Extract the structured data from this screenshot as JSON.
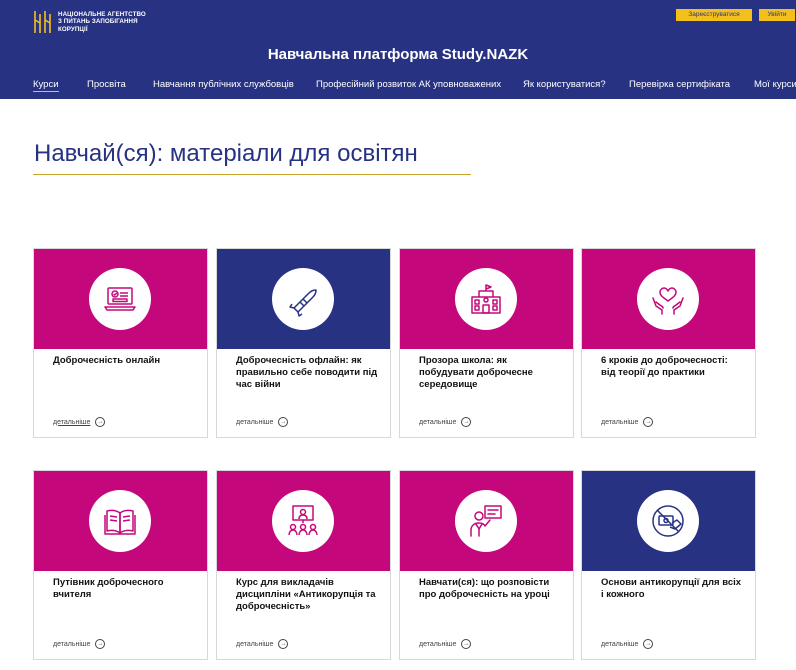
{
  "header": {
    "logo_text": "Національне агентство\nз питань запобігання\nкорупції",
    "register_label": "Зареєструватися",
    "login_label": "Увійти",
    "site_title": "Навчальна платформа Study.NAZK"
  },
  "nav": {
    "items": [
      {
        "label": "Курси"
      },
      {
        "label": "Просвіта"
      },
      {
        "label": "Навчання публічних службовців"
      },
      {
        "label": "Професійний розвиток АК уповноважених"
      },
      {
        "label": "Як користуватися?"
      },
      {
        "label": "Перевірка сертифіката"
      },
      {
        "label": "Мої курси"
      }
    ]
  },
  "page": {
    "title": "Навчай(ся): матеріали для освітян"
  },
  "cards": [
    {
      "title": "Доброчесність онлайн",
      "more": "детальніше",
      "color": "#c4087b",
      "icon": "laptop-certificate-icon"
    },
    {
      "title": "Доброчесність офлайн: як правильно себе поводити під час війни",
      "more": "детальніше",
      "color": "#283283",
      "icon": "missile-icon"
    },
    {
      "title": "Прозора школа: як побудувати доброчесне середовище",
      "more": "детальніше",
      "color": "#c4087b",
      "icon": "school-building-icon"
    },
    {
      "title": "6 кроків до доброчесності: від теорії до практики",
      "more": "детальніше",
      "color": "#c4087b",
      "icon": "hands-heart-icon"
    },
    {
      "title": "Путівник доброчесного вчителя",
      "more": "детальніше",
      "color": "#c4087b",
      "icon": "open-book-icon"
    },
    {
      "title": "Курс для викладачів дисципліни «Антикорупція та доброчесність»",
      "more": "детальніше",
      "color": "#c4087b",
      "icon": "lecture-audience-icon"
    },
    {
      "title": "Навчати(ся): що розповісти про доброчесність на уроці",
      "more": "детальніше",
      "color": "#c4087b",
      "icon": "teacher-board-icon"
    },
    {
      "title": "Основи антикорупції для всіх і кожного",
      "more": "детальніше",
      "color": "#283283",
      "icon": "no-bribe-icon"
    }
  ]
}
